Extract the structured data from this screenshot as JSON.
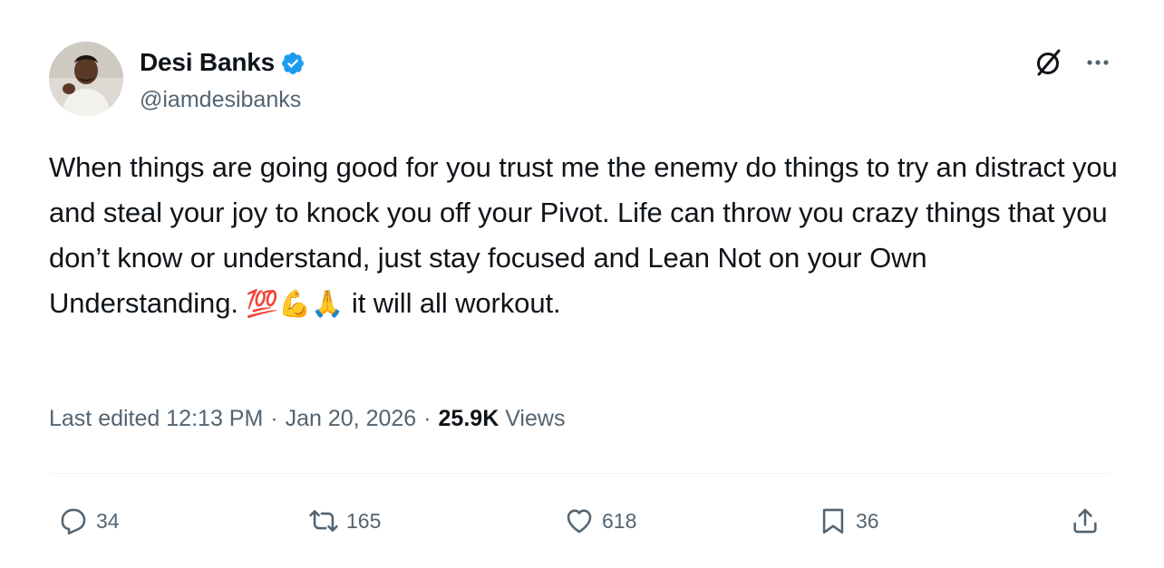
{
  "author": {
    "display_name": "Desi Banks",
    "handle": "@iamdesibanks",
    "verified_color": "#1d9bf0"
  },
  "header_icons": [
    "grok-icon",
    "more-icon"
  ],
  "tweet": {
    "text_main": "When things are going good for you trust me the enemy do things to try an distract you and steal your joy to knock you off your Pivot. Life can throw you crazy things that you don’t know or understand, just stay focused and Lean Not on your Own Understanding.",
    "emojis": "💯💪🙏",
    "text_tail": "it will all workout."
  },
  "meta": {
    "edited_label": "Last edited",
    "time": "12:13 PM",
    "separator": "·",
    "date": "Jan 20, 2026",
    "views_count": "25.9K",
    "views_label": "Views"
  },
  "engagement": {
    "replies": "34",
    "reposts": "165",
    "likes": "618",
    "bookmarks": "36"
  },
  "colors": {
    "text": "#0f1419",
    "secondary": "#536471",
    "divider": "#eff3f4",
    "accent": "#1d9bf0"
  }
}
